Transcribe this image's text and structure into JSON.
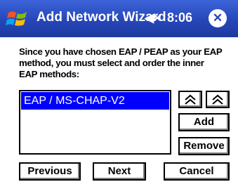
{
  "titlebar": {
    "title": "Add Network Wizard",
    "volume": "◀×",
    "clock": "8:06",
    "close": "✕",
    "background": "#2646b8"
  },
  "instructions": "Since you have chosen EAP / PEAP as your EAP method, you must select and order the inner EAP methods:",
  "method_list": {
    "items": [
      {
        "label": "EAP / MS-CHAP-V2",
        "selected": true
      }
    ],
    "selection_color": "#0000ff"
  },
  "buttons": {
    "move_up_icon": "chevron-double-up",
    "move_down_icon": "chevron-double-up",
    "add": "Add",
    "remove": "Remove",
    "previous": "Previous",
    "next": "Next",
    "cancel": "Cancel"
  }
}
